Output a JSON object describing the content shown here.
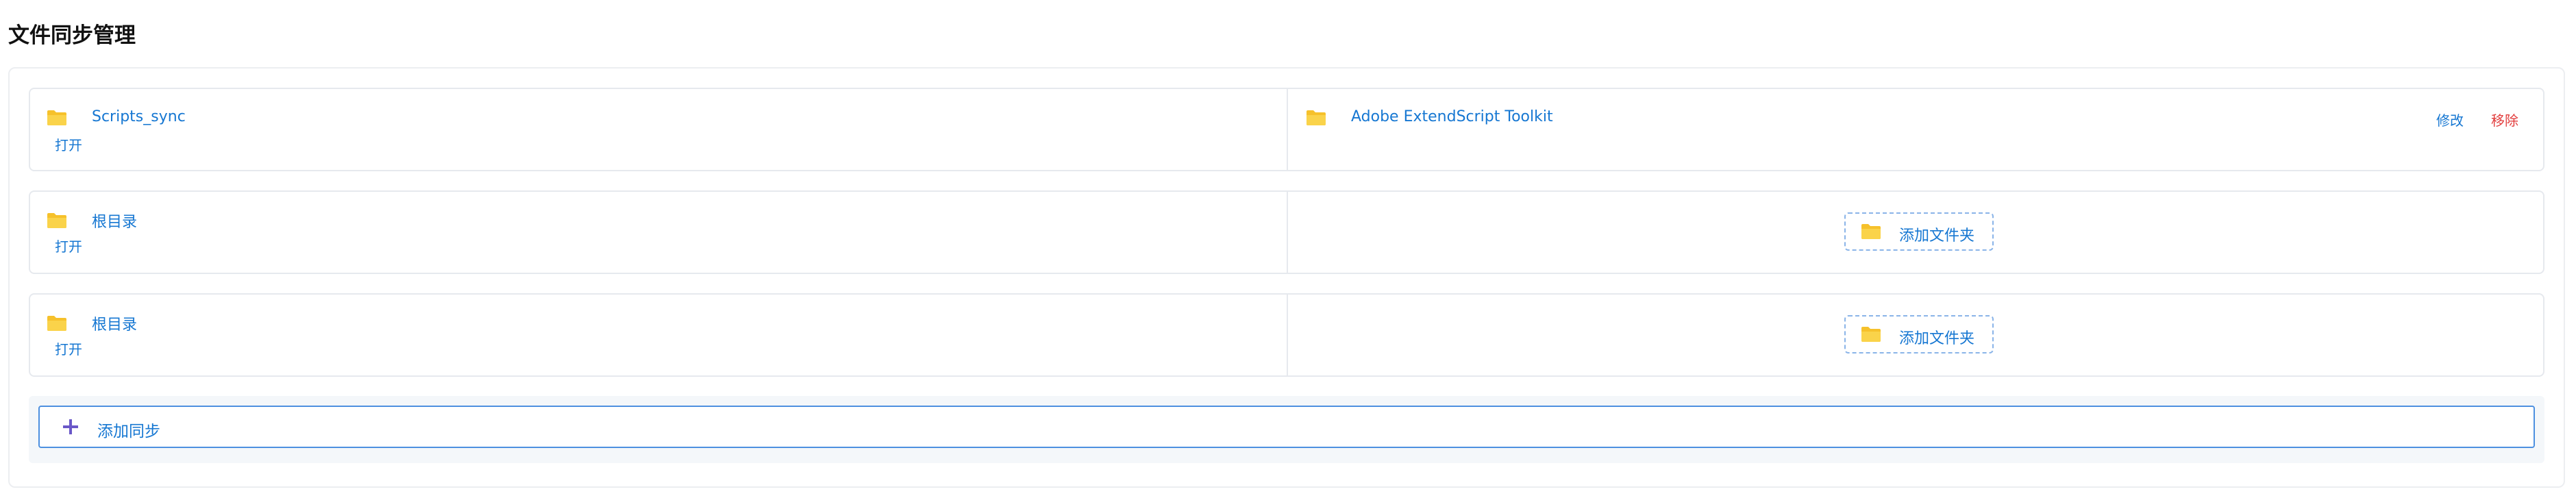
{
  "page": {
    "title": "文件同步管理"
  },
  "sync_rows": [
    {
      "left": {
        "folder_name": "Scripts_sync",
        "open_label": "打开"
      },
      "right": {
        "folder_name": "Adobe ExtendScript Toolkit",
        "edit_label": "修改",
        "remove_label": "移除"
      }
    },
    {
      "left": {
        "folder_name": "根目录",
        "open_label": "打开"
      },
      "right": {
        "add_folder_label": "添加文件夹"
      }
    },
    {
      "left": {
        "folder_name": "根目录",
        "open_label": "打开"
      },
      "right": {
        "add_folder_label": "添加文件夹"
      }
    }
  ],
  "add_sync": {
    "label": "添加同步"
  },
  "icons": {
    "folder": "folder-icon",
    "plus": "plus-icon"
  },
  "colors": {
    "link_blue": "#1677d2",
    "danger_red": "#e23c3c",
    "folder_yellow": "#f6c12b",
    "plus_purple": "#6a58c8"
  }
}
